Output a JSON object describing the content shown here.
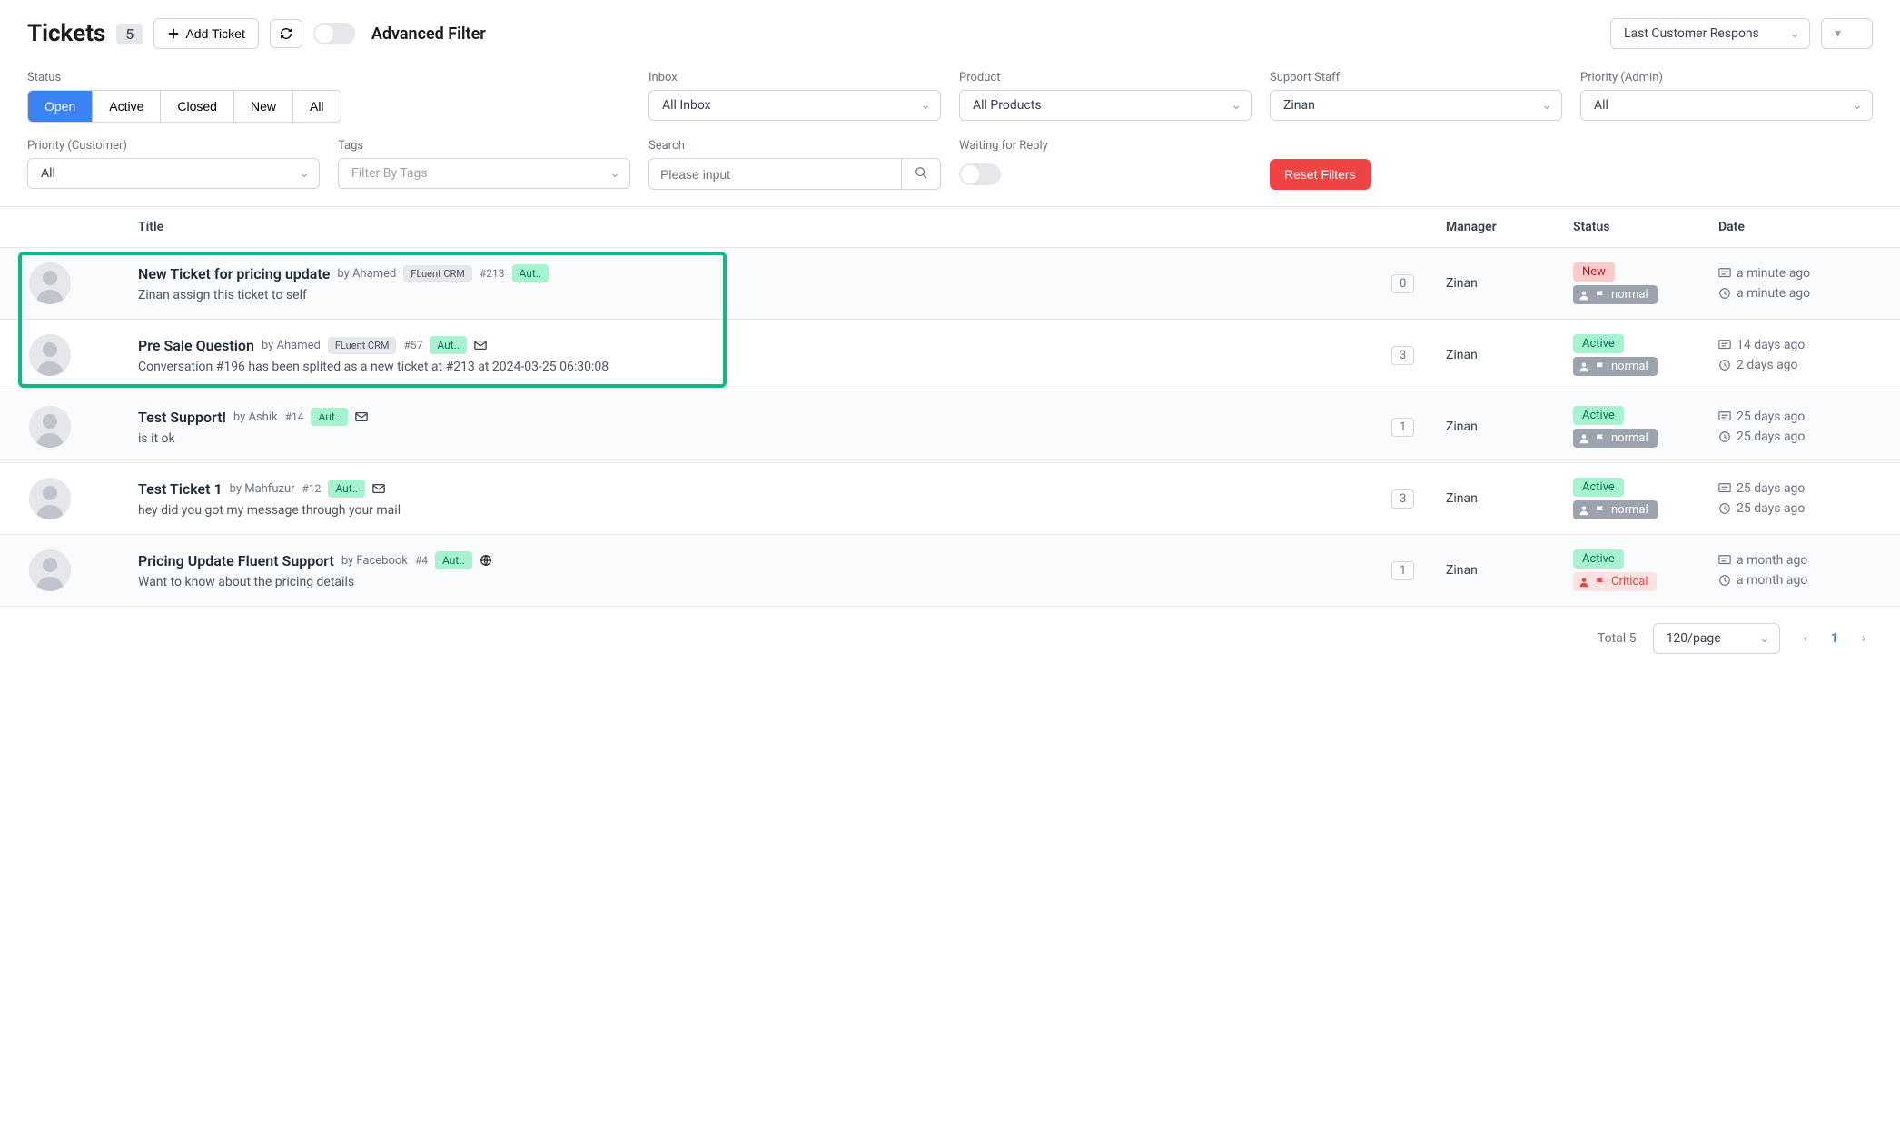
{
  "header": {
    "title": "Tickets",
    "count": "5",
    "add_button": "Add Ticket",
    "advanced_filter": "Advanced Filter",
    "sort_placeholder": "Last Customer Respons"
  },
  "filters": {
    "status_label": "Status",
    "status_options": [
      "Open",
      "Active",
      "Closed",
      "New",
      "All"
    ],
    "inbox_label": "Inbox",
    "inbox_value": "All Inbox",
    "product_label": "Product",
    "product_value": "All Products",
    "staff_label": "Support Staff",
    "staff_value": "Zinan",
    "priority_admin_label": "Priority (Admin)",
    "priority_admin_value": "All",
    "priority_customer_label": "Priority (Customer)",
    "priority_customer_value": "All",
    "tags_label": "Tags",
    "tags_placeholder": "Filter By Tags",
    "search_label": "Search",
    "search_placeholder": "Please input",
    "waiting_label": "Waiting for Reply",
    "reset_label": "Reset Filters"
  },
  "table": {
    "columns": {
      "title": "Title",
      "manager": "Manager",
      "status": "Status",
      "date": "Date"
    },
    "rows": [
      {
        "title": "New Ticket for pricing update",
        "author": "Ahamed",
        "crm": "FLuent CRM",
        "hash": "#213",
        "aut": "Aut..",
        "preview": "Zinan assign this ticket to self",
        "count": "0",
        "manager": "Zinan",
        "status": "New",
        "priority": "normal",
        "priority_critical": false,
        "date1": "a minute ago",
        "date2": "a minute ago",
        "mail_icon": false,
        "globe_icon": false
      },
      {
        "title": "Pre Sale Question",
        "author": "Ahamed",
        "crm": "FLuent CRM",
        "hash": "#57",
        "aut": "Aut..",
        "preview": "Conversation #196 has been splited as a new ticket at #213 at 2024-03-25 06:30:08",
        "count": "3",
        "manager": "Zinan",
        "status": "Active",
        "priority": "normal",
        "priority_critical": false,
        "date1": "14 days ago",
        "date2": "2 days ago",
        "mail_icon": true,
        "globe_icon": false
      },
      {
        "title": "Test Support!",
        "author": "Ashik",
        "crm": "",
        "hash": "#14",
        "aut": "Aut..",
        "preview": "is it ok",
        "count": "1",
        "manager": "Zinan",
        "status": "Active",
        "priority": "normal",
        "priority_critical": false,
        "date1": "25 days ago",
        "date2": "25 days ago",
        "mail_icon": true,
        "globe_icon": false
      },
      {
        "title": "Test Ticket 1",
        "author": "Mahfuzur",
        "crm": "",
        "hash": "#12",
        "aut": "Aut..",
        "preview": "hey did you got my message through your mail",
        "count": "3",
        "manager": "Zinan",
        "status": "Active",
        "priority": "normal",
        "priority_critical": false,
        "date1": "25 days ago",
        "date2": "25 days ago",
        "mail_icon": true,
        "globe_icon": false
      },
      {
        "title": "Pricing Update Fluent Support",
        "author": "Facebook",
        "crm": "",
        "hash": "#4",
        "aut": "Aut..",
        "preview": "Want to know about the pricing details",
        "count": "1",
        "manager": "Zinan",
        "status": "Active",
        "priority": "Critical",
        "priority_critical": true,
        "date1": "a month ago",
        "date2": "a month ago",
        "mail_icon": false,
        "globe_icon": true
      }
    ]
  },
  "pager": {
    "total": "Total 5",
    "per_page": "120/page",
    "current": "1"
  }
}
